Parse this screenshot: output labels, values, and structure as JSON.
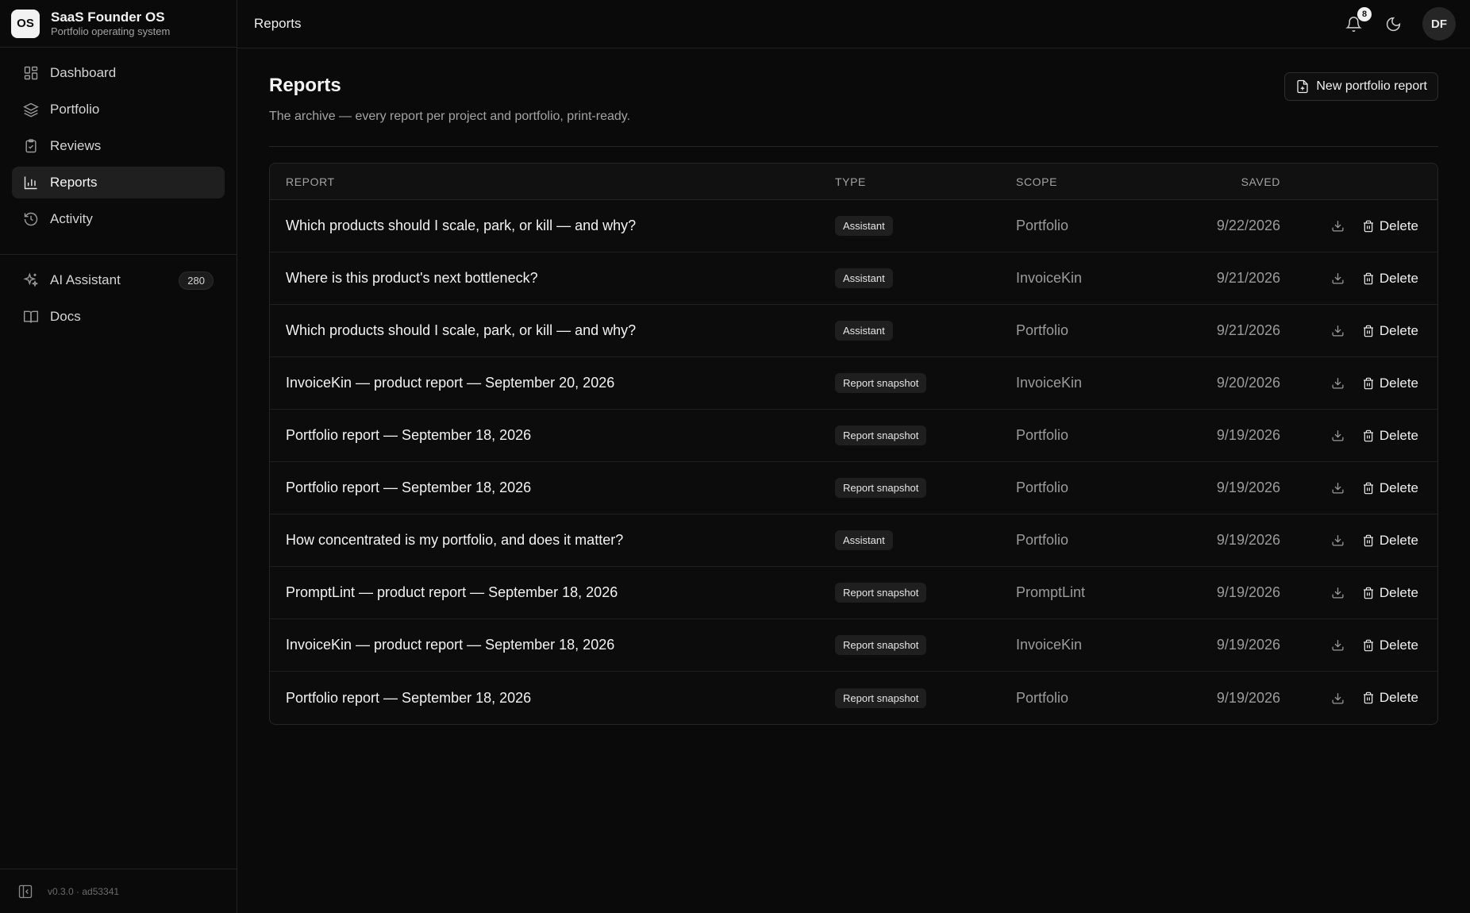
{
  "brand": {
    "logo": "OS",
    "name": "SaaS Founder OS",
    "subtitle": "Portfolio operating system"
  },
  "sidebar": {
    "items": [
      {
        "label": "Dashboard",
        "icon": "dashboard-grid-icon"
      },
      {
        "label": "Portfolio",
        "icon": "layers-icon"
      },
      {
        "label": "Reviews",
        "icon": "clipboard-check-icon"
      },
      {
        "label": "Reports",
        "icon": "bar-chart-icon",
        "active": true
      },
      {
        "label": "Activity",
        "icon": "history-icon"
      }
    ],
    "secondary": [
      {
        "label": "AI Assistant",
        "icon": "sparkles-icon",
        "badge": "280"
      },
      {
        "label": "Docs",
        "icon": "book-icon"
      }
    ],
    "footer": {
      "version": "v0.3.0 · ad53341"
    }
  },
  "topbar": {
    "title": "Reports",
    "notifications": "8",
    "avatar": "DF"
  },
  "page": {
    "title": "Reports",
    "description": "The archive — every report per project and portfolio, print-ready.",
    "new_button": "New portfolio report"
  },
  "table": {
    "headers": {
      "report": "Report",
      "type": "Type",
      "scope": "Scope",
      "saved": "Saved"
    },
    "delete_label": "Delete",
    "rows": [
      {
        "report": "Which products should I scale, park, or kill — and why?",
        "type": "Assistant",
        "scope": "Portfolio",
        "saved": "9/22/2026"
      },
      {
        "report": "Where is this product's next bottleneck?",
        "type": "Assistant",
        "scope": "InvoiceKin",
        "saved": "9/21/2026"
      },
      {
        "report": "Which products should I scale, park, or kill — and why?",
        "type": "Assistant",
        "scope": "Portfolio",
        "saved": "9/21/2026"
      },
      {
        "report": "InvoiceKin — product report — September 20, 2026",
        "type": "Report snapshot",
        "scope": "InvoiceKin",
        "saved": "9/20/2026"
      },
      {
        "report": "Portfolio report — September 18, 2026",
        "type": "Report snapshot",
        "scope": "Portfolio",
        "saved": "9/19/2026"
      },
      {
        "report": "Portfolio report — September 18, 2026",
        "type": "Report snapshot",
        "scope": "Portfolio",
        "saved": "9/19/2026"
      },
      {
        "report": "How concentrated is my portfolio, and does it matter?",
        "type": "Assistant",
        "scope": "Portfolio",
        "saved": "9/19/2026"
      },
      {
        "report": "PromptLint — product report — September 18, 2026",
        "type": "Report snapshot",
        "scope": "PromptLint",
        "saved": "9/19/2026"
      },
      {
        "report": "InvoiceKin — product report — September 18, 2026",
        "type": "Report snapshot",
        "scope": "InvoiceKin",
        "saved": "9/19/2026"
      },
      {
        "report": "Portfolio report — September 18, 2026",
        "type": "Report snapshot",
        "scope": "Portfolio",
        "saved": "9/19/2026"
      }
    ]
  }
}
